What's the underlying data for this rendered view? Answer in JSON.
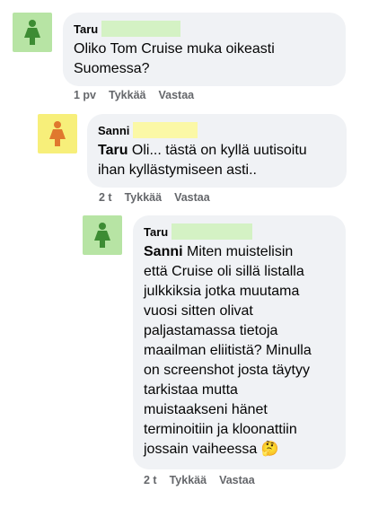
{
  "colors": {
    "bubble_bg": "#f0f2f5",
    "meta_text": "#65676b",
    "taru_avatar_bg": "#b7e4a4",
    "taru_avatar_fg": "#3d8c33",
    "sanni_avatar_bg": "#f7ef7a",
    "sanni_avatar_fg": "#e0782e",
    "name_highlight": "#d4f2c4",
    "name_highlight_yellow": "#fbf8a6"
  },
  "comments": [
    {
      "author": "Taru",
      "avatar_icon": "woman-icon",
      "lines": [
        "Oliko Tom Cruise muka oikeasti",
        "Suomessa?"
      ],
      "time": "1 pv",
      "like": "Tykkää",
      "reply": "Vastaa"
    },
    {
      "author": "Sanni",
      "avatar_icon": "woman-icon",
      "mention": "Taru",
      "lines": [
        " Oli... tästä on kyllä uutisoitu",
        "ihan kyllästymiseen asti.."
      ],
      "time": "2 t",
      "like": "Tykkää",
      "reply": "Vastaa"
    },
    {
      "author": "Taru",
      "avatar_icon": "woman-icon",
      "mention": "Sanni",
      "lines": [
        " Miten muistelisin",
        "että Cruise oli sillä listalla",
        "julkkiksia jotka muutama",
        "vuosi sitten olivat",
        "paljastamassa tietoja",
        "maailman eliitistä? Minulla",
        "on screenshot josta täytyy",
        "tarkistaa mutta",
        "muistaakseni hänet",
        "terminoitiin ja kloonattiin",
        "jossain vaiheessa"
      ],
      "emoji": "🤔",
      "time": "2 t",
      "like": "Tykkää",
      "reply": "Vastaa"
    }
  ]
}
